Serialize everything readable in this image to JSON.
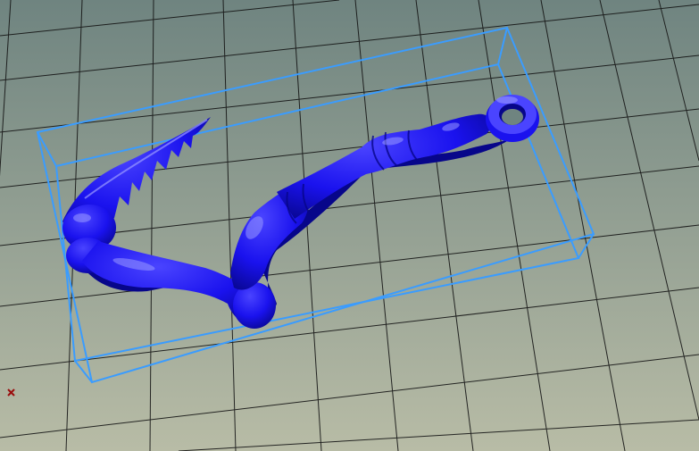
{
  "viewport": {
    "background_top": "#6f8480",
    "background_bottom": "#b8bca6",
    "grid_color": "#141414",
    "bounding_box_color": "#3a9cff",
    "model_color": "#1a12ee",
    "model_highlight": "#9a9aff",
    "model_shadow": "#07068a",
    "origin_marker_color": "#9a0d0d"
  },
  "scene": {
    "model": "bone-claw-keychain-model",
    "bounding_box": "model-bounding-box",
    "origin_marker": "origin-axis-marker"
  }
}
